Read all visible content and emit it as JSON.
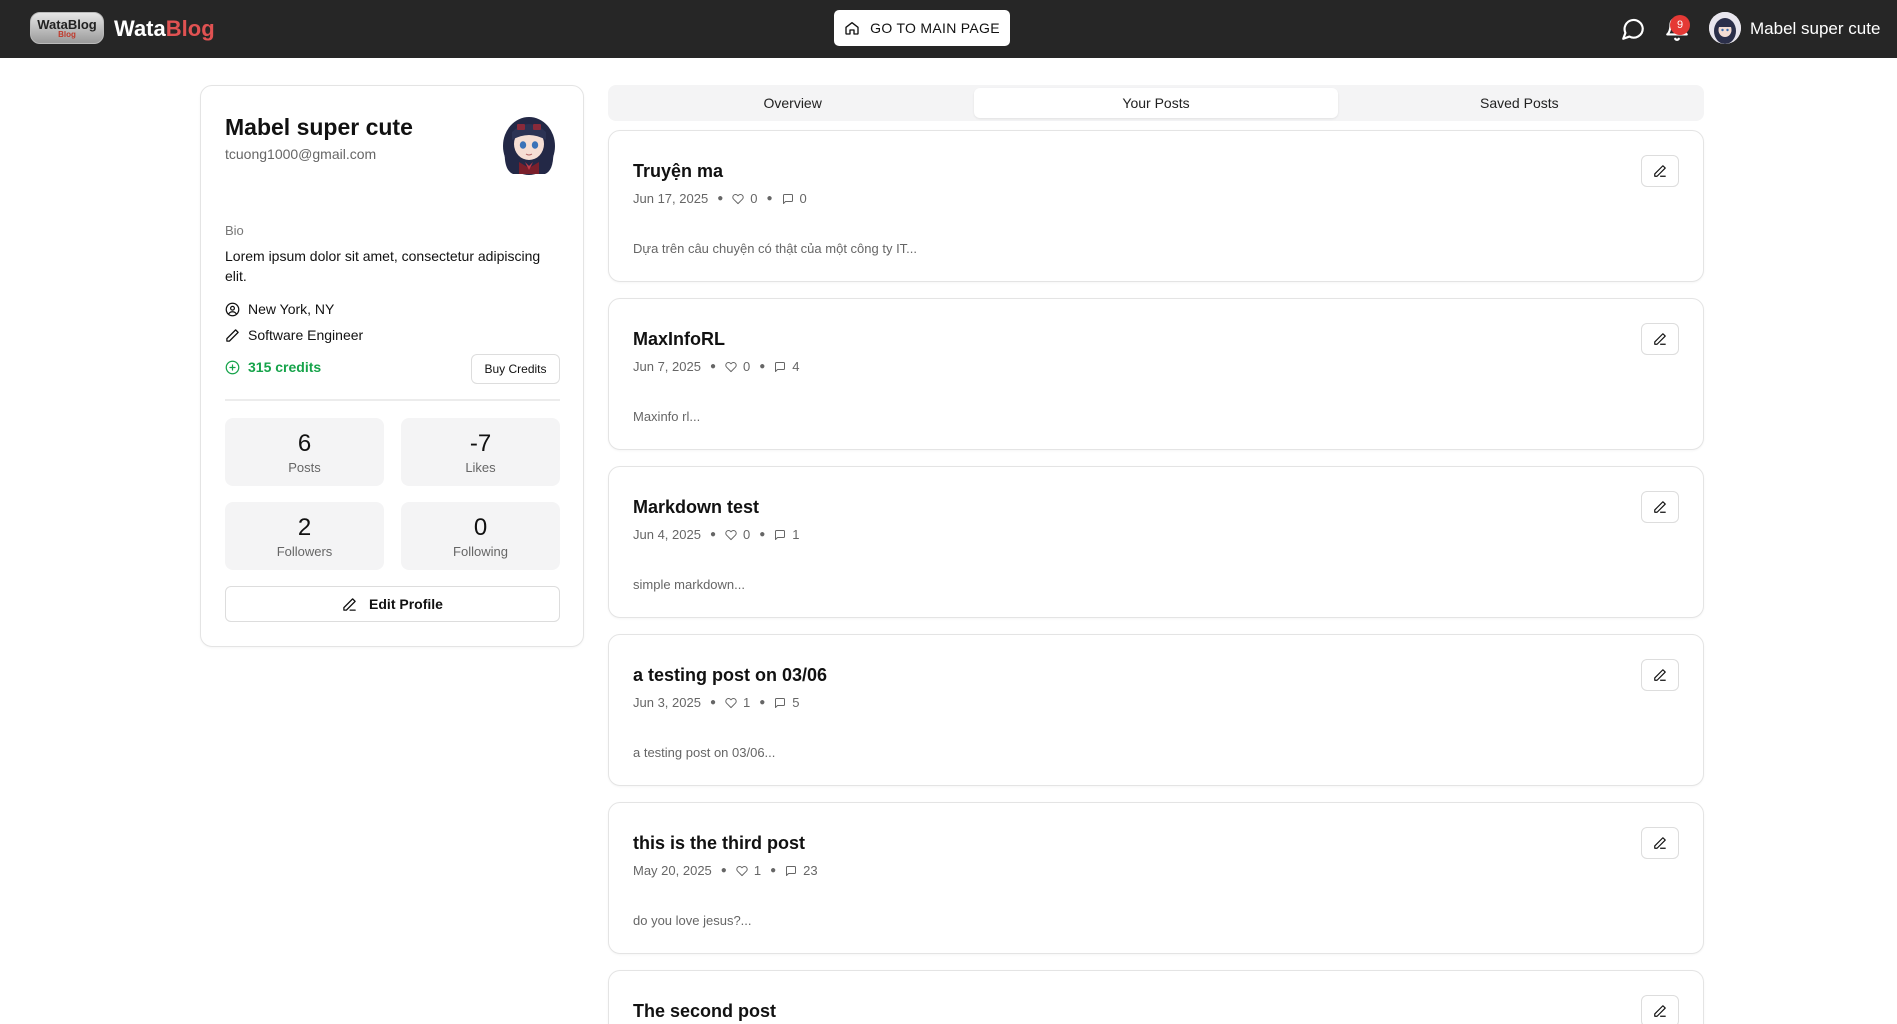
{
  "header": {
    "logo_text": "WataBlog",
    "logo_sub": "Blog",
    "brand_part1": "Wata",
    "brand_part2": "Blog",
    "main_page_label": "GO TO MAIN PAGE",
    "notification_count": "9",
    "user_name": "Mabel super cute",
    "brand_accent_color": "#e05252"
  },
  "profile": {
    "name": "Mabel super cute",
    "email": "tcuong1000@gmail.com",
    "bio_label": "Bio",
    "bio": "Lorem ipsum dolor sit amet, consectetur adipiscing elit.",
    "location": "New York, NY",
    "job": "Software Engineer",
    "credits": "315 credits",
    "buy_credits_label": "Buy Credits",
    "stats": [
      {
        "value": "6",
        "label": "Posts"
      },
      {
        "value": "-7",
        "label": "Likes"
      },
      {
        "value": "2",
        "label": "Followers"
      },
      {
        "value": "0",
        "label": "Following"
      }
    ],
    "edit_label": "Edit Profile",
    "credits_color": "#16a34a"
  },
  "tabs": [
    {
      "label": "Overview",
      "active": false
    },
    {
      "label": "Your Posts",
      "active": true
    },
    {
      "label": "Saved Posts",
      "active": false
    }
  ],
  "posts": [
    {
      "title": "Truyện ma",
      "date": "Jun 17, 2025",
      "likes": "0",
      "comments": "0",
      "snippet": "Dựa trên câu chuyện có thật của một công ty IT..."
    },
    {
      "title": "MaxInfoRL",
      "date": "Jun 7, 2025",
      "likes": "0",
      "comments": "4",
      "snippet": "Maxinfo rl..."
    },
    {
      "title": "Markdown test",
      "date": "Jun 4, 2025",
      "likes": "0",
      "comments": "1",
      "snippet": "simple markdown..."
    },
    {
      "title": "a testing post on 03/06",
      "date": "Jun 3, 2025",
      "likes": "1",
      "comments": "5",
      "snippet": "a testing post on 03/06..."
    },
    {
      "title": "this is the third post",
      "date": "May 20, 2025",
      "likes": "1",
      "comments": "23",
      "snippet": "do you love jesus?..."
    },
    {
      "title": "The second post",
      "date": "",
      "likes": "",
      "comments": "",
      "snippet": ""
    }
  ]
}
